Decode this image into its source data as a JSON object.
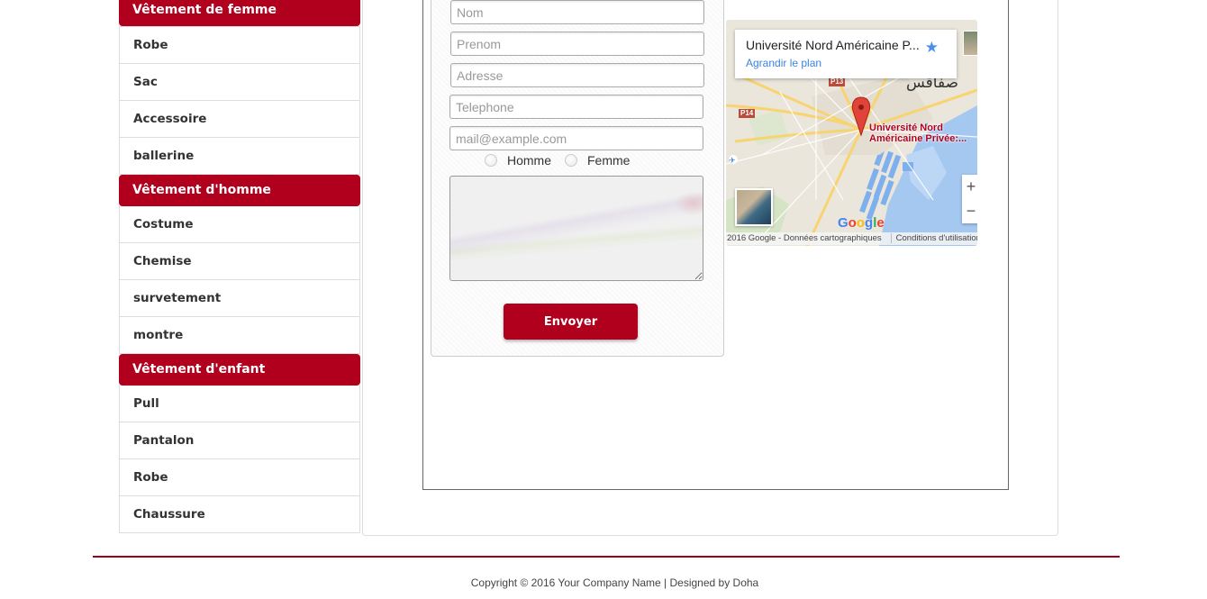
{
  "sidebar": {
    "categories": [
      {
        "title": "Vêtement de femme",
        "items": [
          "Robe",
          "Sac",
          "Accessoire",
          "ballerine"
        ]
      },
      {
        "title": "Vêtement d'homme",
        "items": [
          "Costume",
          "Chemise",
          "survetement",
          "montre"
        ]
      },
      {
        "title": "Vêtement d'enfant",
        "items": [
          "Pull",
          "Pantalon",
          "Robe",
          "Chaussure"
        ]
      }
    ]
  },
  "form": {
    "nom_placeholder": "Nom",
    "prenom_placeholder": "Prenom",
    "adresse_placeholder": "Adresse",
    "telephone_placeholder": "Telephone",
    "email_placeholder": "mail@example.com",
    "gender_male": "Homme",
    "gender_female": "Femme",
    "submit_label": "Envoyer"
  },
  "map": {
    "place_title": "Université Nord Américaine P...",
    "enlarge_link": "Agrandir le plan",
    "pin_label_line1": "Université Nord",
    "pin_label_line2": "Américaine Privée:...",
    "city_label": "صفاقس",
    "road_p13": "P13",
    "road_p14": "P14",
    "zoom_in": "+",
    "zoom_out": "−",
    "attribution": "2016 Google - Données cartographiques",
    "terms": "Conditions d'utilisation",
    "logo_text": [
      "G",
      "o",
      "o",
      "g",
      "l",
      "e"
    ],
    "logo_colors": [
      "#4285f4",
      "#ea4335",
      "#fbbc05",
      "#4285f4",
      "#34a853",
      "#ea4335"
    ]
  },
  "footer": {
    "text": "Copyright © 2016 Your Company Name | Designed by Doha"
  },
  "colors": {
    "brand": "#b0001e",
    "link": "#3a84df"
  }
}
